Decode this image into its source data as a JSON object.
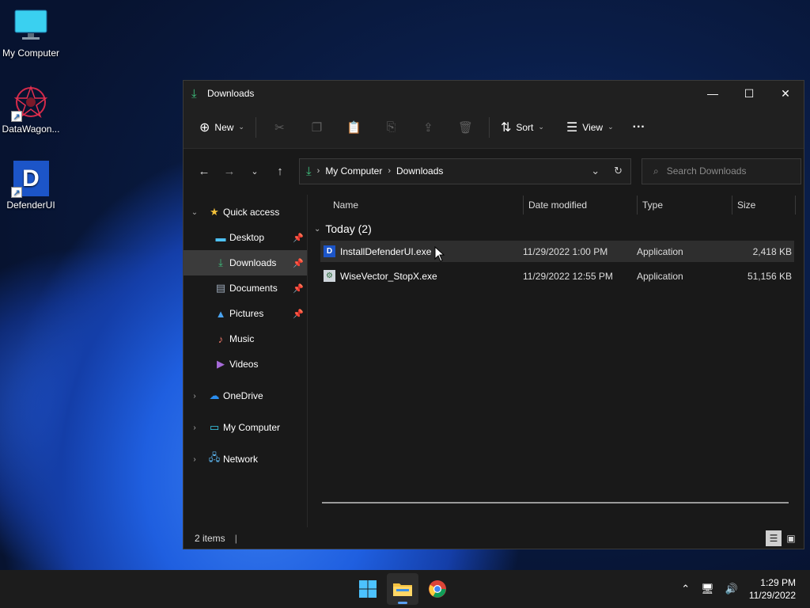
{
  "desktop": {
    "icons": [
      {
        "label": "My Computer"
      },
      {
        "label": "DataWagon..."
      },
      {
        "label": "DefenderUI"
      }
    ]
  },
  "window": {
    "title": "Downloads",
    "controls": {
      "minimize": "—",
      "maximize": "☐",
      "close": "✕"
    }
  },
  "toolbar": {
    "new_label": "New",
    "sort_label": "Sort",
    "view_label": "View",
    "more_label": "···"
  },
  "address": {
    "crumbs": [
      "My Computer",
      "Downloads"
    ]
  },
  "search": {
    "placeholder": "Search Downloads"
  },
  "sidebar": {
    "quick_access": "Quick access",
    "items": [
      {
        "label": "Desktop"
      },
      {
        "label": "Downloads"
      },
      {
        "label": "Documents"
      },
      {
        "label": "Pictures"
      },
      {
        "label": "Music"
      },
      {
        "label": "Videos"
      }
    ],
    "roots": [
      {
        "label": "OneDrive"
      },
      {
        "label": "My Computer"
      },
      {
        "label": "Network"
      }
    ]
  },
  "columns": {
    "name": "Name",
    "date": "Date modified",
    "type": "Type",
    "size": "Size"
  },
  "group": {
    "label": "Today (2)"
  },
  "files": [
    {
      "name": "InstallDefenderUI.exe",
      "date": "11/29/2022 1:00 PM",
      "type": "Application",
      "size": "2,418 KB"
    },
    {
      "name": "WiseVector_StopX.exe",
      "date": "11/29/2022 12:55 PM",
      "type": "Application",
      "size": "51,156 KB"
    }
  ],
  "status": {
    "count": "2 items"
  },
  "clock": {
    "time": "1:29 PM",
    "date": "11/29/2022"
  },
  "colors": {
    "accent_green": "#3ec27e",
    "taskbar_indicator": "#5aa0f2"
  }
}
